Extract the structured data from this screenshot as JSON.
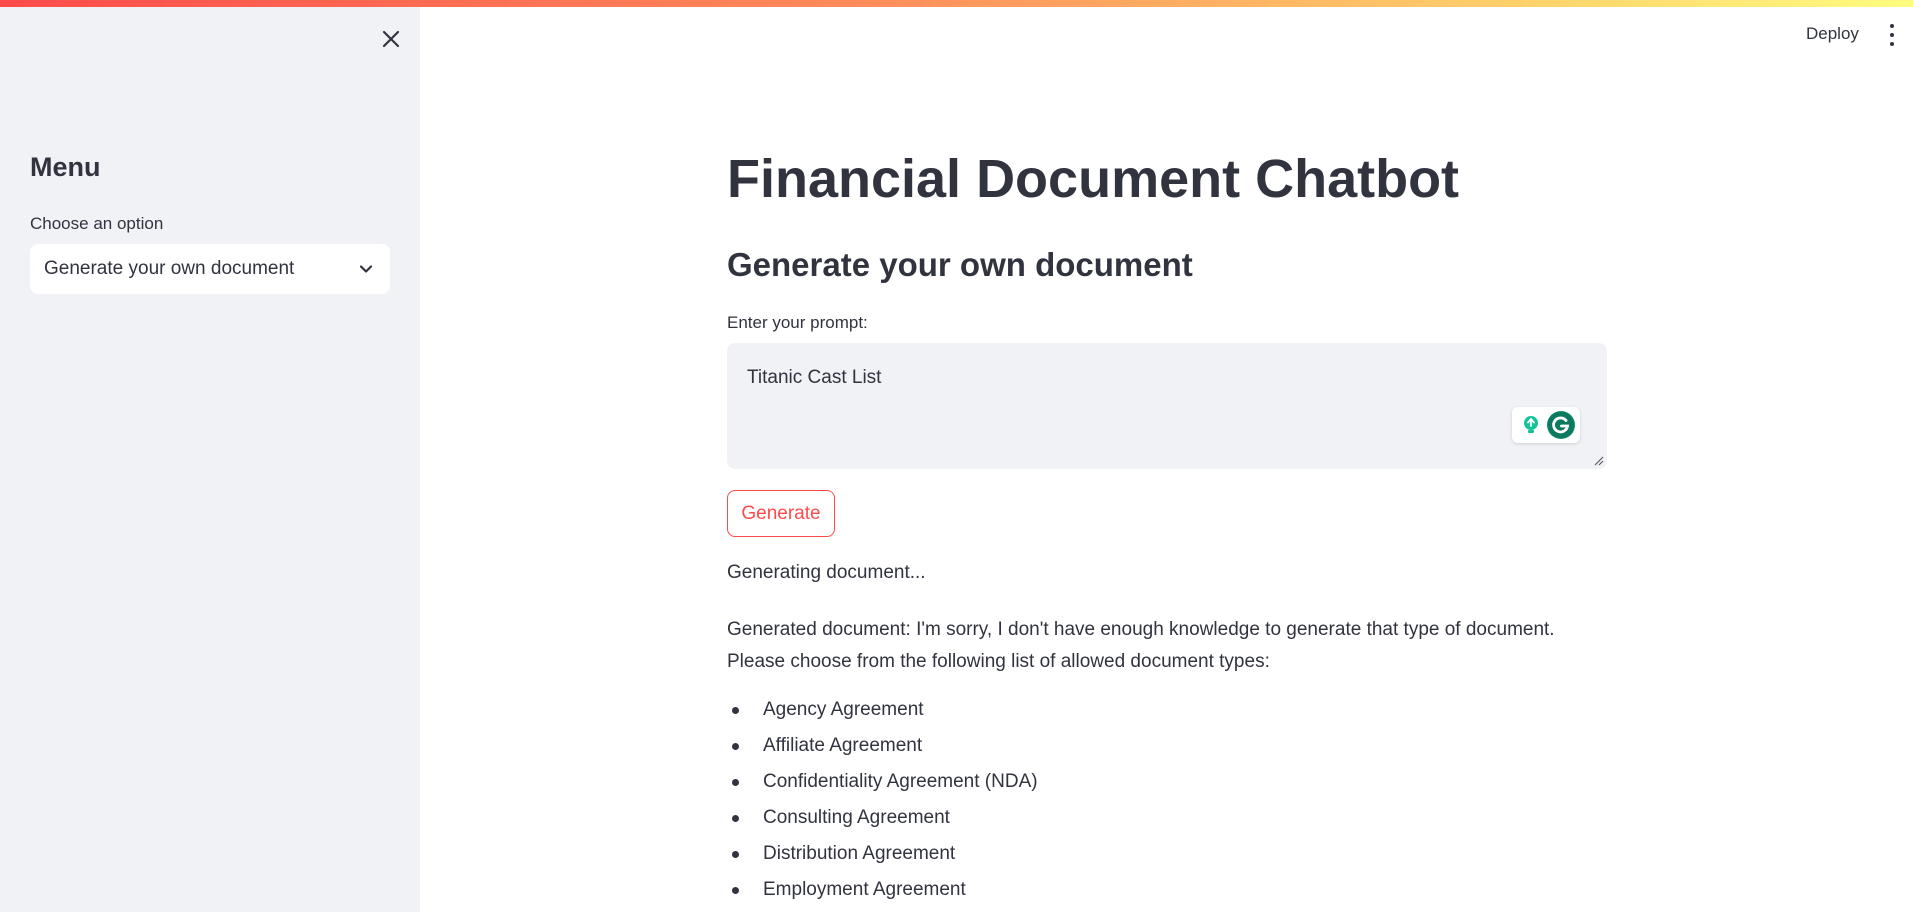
{
  "sidebar": {
    "title": "Menu",
    "select_label": "Choose an option",
    "select_value": "Generate your own document"
  },
  "header": {
    "deploy_label": "Deploy"
  },
  "main": {
    "title": "Financial Document Chatbot",
    "subtitle": "Generate your own document",
    "prompt_label": "Enter your prompt:",
    "prompt_value": "Titanic Cast List",
    "generate_label": "Generate",
    "status": "Generating document...",
    "result_line1": "Generated document: I'm sorry, I don't have enough knowledge to generate that type of document.",
    "result_line2": "Please choose from the following list of allowed document types:",
    "document_types": [
      "Agency Agreement",
      "Affiliate Agreement",
      "Confidentiality Agreement (NDA)",
      "Consulting Agreement",
      "Distribution Agreement",
      "Employment Agreement"
    ]
  },
  "colors": {
    "accent": "#ff4b4b",
    "sidebar_bg": "#f0f2f6",
    "text": "#31333f"
  },
  "icons": [
    "close-icon",
    "chevron-down-icon",
    "more-vert-icon",
    "grammarly-bulb-icon",
    "grammarly-g-icon",
    "resize-grip-icon"
  ]
}
